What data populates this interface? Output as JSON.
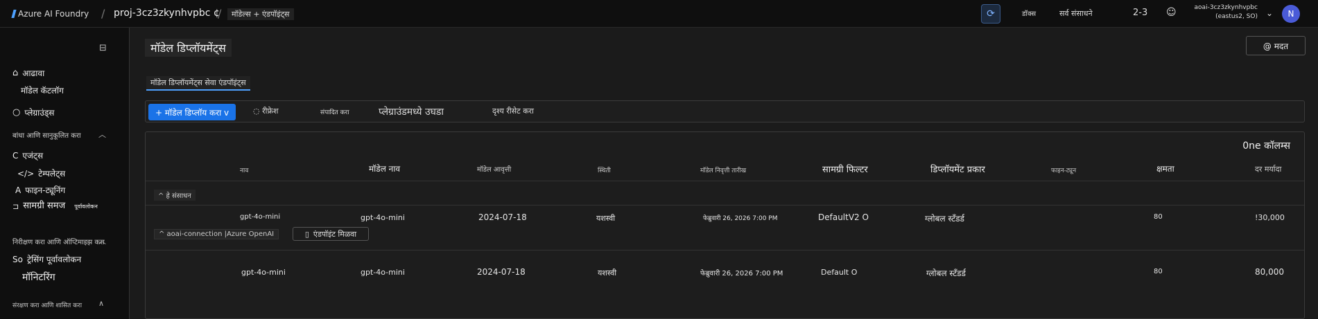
{
  "topbar": {
    "brand": "Azure AI Foundry",
    "project": "proj-3cz3zkynhvpbc",
    "project_suffix": "¢",
    "breadcrumb": "मॉडेल्स + एंडपॉइंट्स",
    "docs": "डॉक्स",
    "all_resources": "सर्व संसाधने",
    "count": "2-3",
    "account_name": "aoai-3cz3zkynhvpbc",
    "account_region": "(eastus2, SO)",
    "avatar_initial": "N"
  },
  "sidebar": {
    "overview": "आढावा",
    "model_catalog": "मॉडेल कॅटलॉग",
    "playgrounds": "प्लेग्राउंड्स",
    "section_build": "बांधा आणि सानुकूलित करा",
    "agents": "एजंट्स",
    "agents_prefix": "C",
    "templates": "टेम्पलेट्स",
    "templates_prefix": "</>",
    "finetuning": "फाइन-ट्यूनिंग",
    "finetuning_prefix": "A",
    "content_understanding": "सामग्री समज",
    "content_preview": "पूर्वावलोकन",
    "section_observe": "निरीक्षण करा आणि ऑप्टिमाइझ करा",
    "tracing": "ट्रेसिंग पूर्वावलोकन",
    "tracing_prefix": "So",
    "monitoring": "मॉनिटरिंग",
    "section_protect": "संरक्षण करा आणि शासित करा"
  },
  "main": {
    "title": "मॉडेल डिप्लॉयमेंट्स",
    "help": "@ मदत",
    "tab": "मॉडेल डिप्लॉयमेंट्स सेवा एंडपॉइंट्स",
    "deploy_btn": "+ मॉडेल डिप्लॉय करा v",
    "refresh": "रीफ्रेश",
    "edit": "संपादित करा",
    "open_playground": "प्लेग्राउंडमध्ये उघडा",
    "reset_view": "दृश्य रीसेट करा",
    "columns": "0ne कॉलम्स"
  },
  "table": {
    "headers": {
      "name": "नाव",
      "model_name": "मॉडेल नाव",
      "model_version": "मॉडेल आवृत्ती",
      "state": "स्थिती",
      "retirement": "मॉडेल निवृत्ती तारीख",
      "content_filter": "सामग्री फिल्टर",
      "deploy_type": "डिप्लॉयमेंट प्रकार",
      "finetune": "फाइन-ट्यून",
      "capacity": "क्षमता",
      "rate_limit": "दर मर्यादा"
    },
    "group_label": "^ हे संसाधन",
    "connection_label": "^ aoai-connection |Azure OpenAI",
    "get_endpoint": "एंडपॉइंट मिळवा",
    "rows": [
      {
        "name": "gpt-4o-mini",
        "model_name": "gpt-4o-mini",
        "version": "2024-07-18",
        "state": "यशस्वी",
        "retirement": "फेब्रुवारी 26, 2026 7:00 PM",
        "content_filter": "DefaultV2 O",
        "deploy_type": "ग्लोबल स्टँडर्ड",
        "capacity": "80",
        "rate_limit": "!30,000"
      },
      {
        "name": "gpt-4o-mini",
        "model_name": "gpt-4o-mini",
        "version": "2024-07-18",
        "state": "यशस्वी",
        "retirement": "फेब्रुवारी 26, 2026 7:00 PM",
        "content_filter": "Default O",
        "deploy_type": "ग्लोबल स्टँडर्ड",
        "capacity": "80",
        "rate_limit": "80,000"
      }
    ]
  }
}
